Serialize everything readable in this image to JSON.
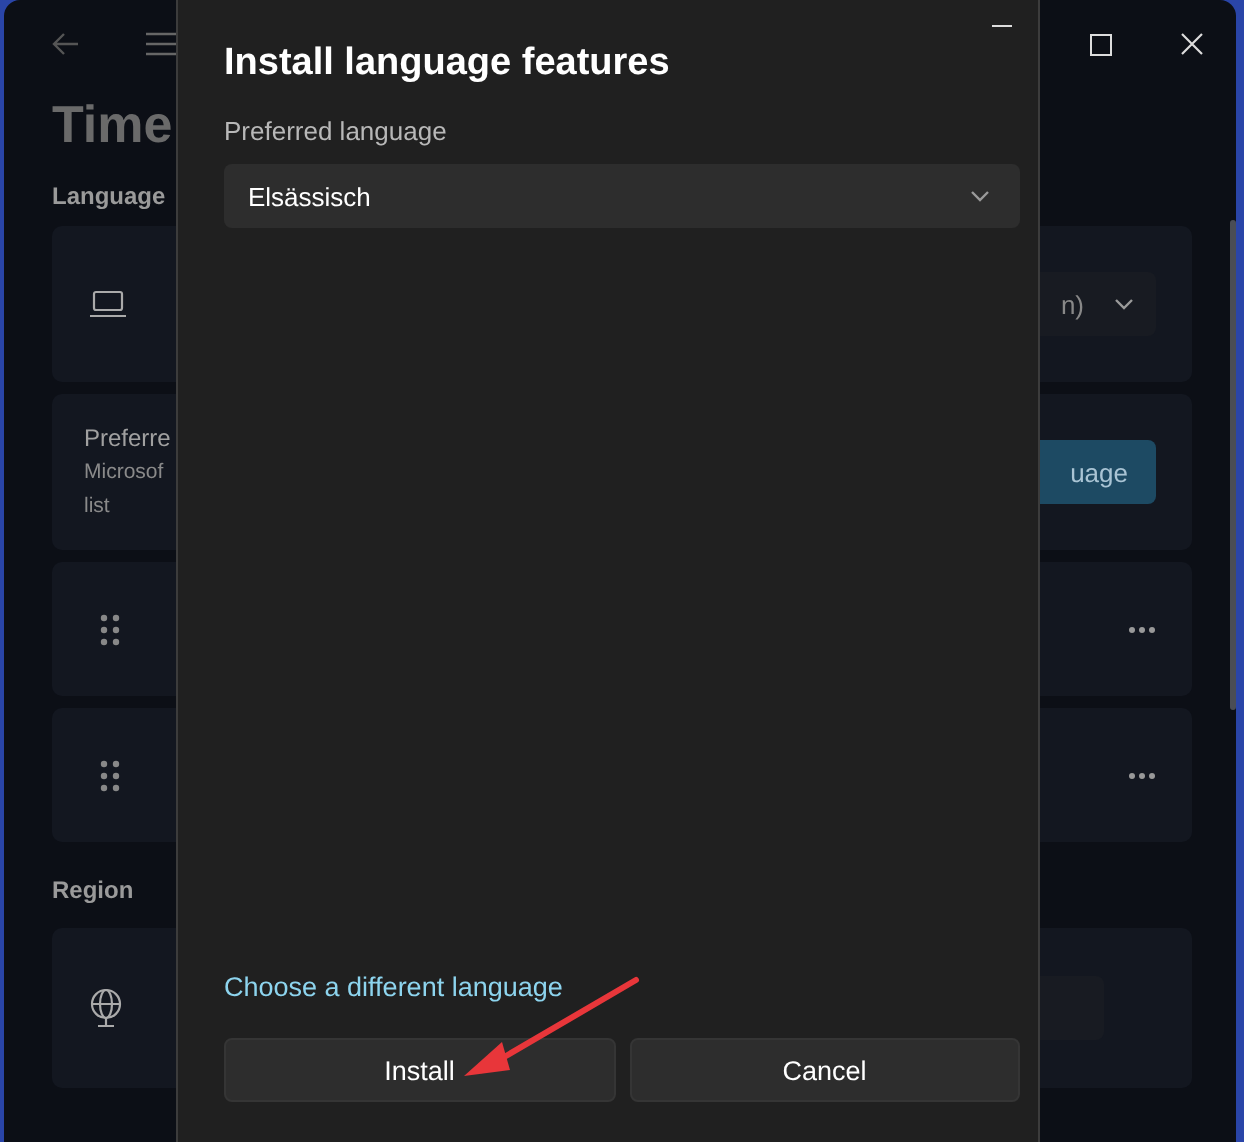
{
  "background_window": {
    "title": "Time",
    "sections": [
      {
        "heading": "Language",
        "cards": [
          {
            "kind": "display",
            "control": "n)"
          },
          {
            "kind": "preferred",
            "lines": [
              "Preferre",
              "Microsof",
              "list"
            ],
            "button": "uage"
          },
          {
            "kind": "language"
          },
          {
            "kind": "language"
          }
        ]
      },
      {
        "heading": "Region",
        "cards": [
          {
            "kind": "country"
          }
        ]
      }
    ]
  },
  "dialog": {
    "title": "Install language features",
    "field_label": "Preferred language",
    "dropdown": {
      "value": "Elsässisch"
    },
    "link": "Choose a different language",
    "buttons": [
      "Install",
      "Cancel"
    ]
  }
}
